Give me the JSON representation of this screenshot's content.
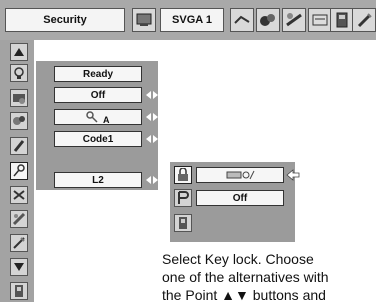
{
  "header": {
    "title": "Security",
    "mode": "SVGA 1"
  },
  "toolbar_icons": [
    "pc-adjust-icon",
    "image-select-icon",
    "image-adjust-icon",
    "screen-icon",
    "setting-icon",
    "info-icon",
    "expand-icon"
  ],
  "sidebar_icons": [
    "up-arrow-icon",
    "lamp-icon",
    "input-icon",
    "image-icon",
    "screen-icon",
    "security-key-icon",
    "fan-icon",
    "setting-icon",
    "tools-icon",
    "down-arrow-icon",
    "exit-icon"
  ],
  "panel": {
    "rows": [
      {
        "value": "Ready",
        "has_arrows": false
      },
      {
        "value": "Off",
        "has_arrows": true
      },
      {
        "value": "A",
        "has_arrows": true
      },
      {
        "value": "Code1",
        "has_arrows": true
      },
      {
        "value": "L2",
        "has_arrows": true
      }
    ]
  },
  "popup": {
    "rows": [
      {
        "icon": "key-lock-icon",
        "value": "remote-control-lock"
      },
      {
        "icon": "projector-lock-icon",
        "value": "Off"
      }
    ],
    "exit_icon": "exit-icon"
  },
  "help": {
    "line1": "Select Key lock.  Choose",
    "line2": "one of the alternatives with",
    "line3": "the Point ▲▼ buttons and"
  },
  "colors": {
    "frame": "#a9a9a9",
    "panel": "#9b9b9b",
    "box": "#f6f6f6"
  }
}
